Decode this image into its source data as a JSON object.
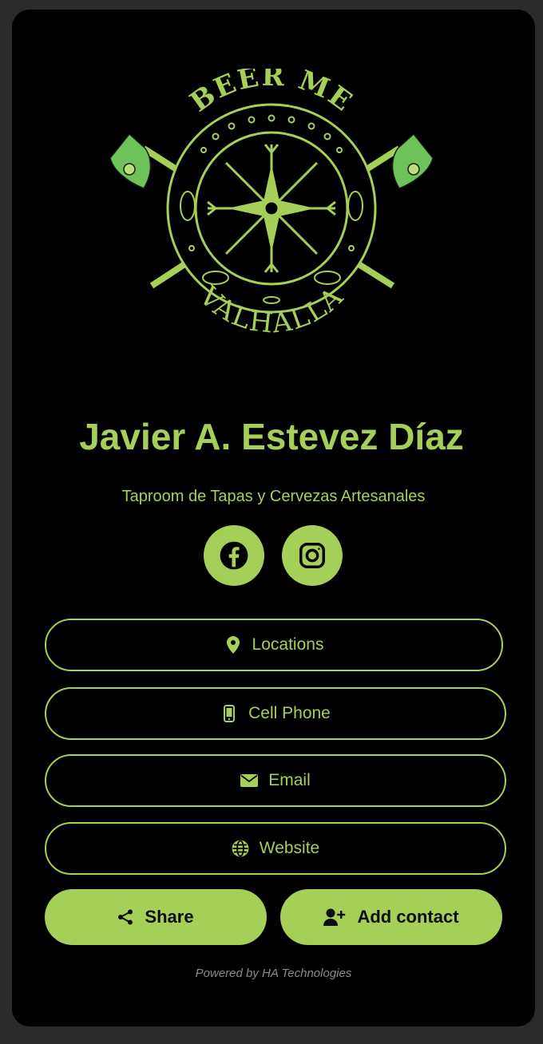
{
  "profile": {
    "logo_top_text": "BEER ME",
    "logo_bottom_text": "VALHALLA",
    "name": "Javier A. Estevez Díaz",
    "tagline": "Taproom de Tapas y Cervezas Artesanales"
  },
  "social": [
    {
      "icon": "facebook-icon"
    },
    {
      "icon": "instagram-icon"
    }
  ],
  "links": {
    "locations": {
      "label": "Locations",
      "icon": "map-pin-icon"
    },
    "cell_phone": {
      "label": "Cell Phone",
      "icon": "mobile-phone-icon"
    },
    "email": {
      "label": "Email",
      "icon": "envelope-icon"
    },
    "website": {
      "label": "Website",
      "icon": "globe-icon"
    }
  },
  "actions": {
    "share": {
      "label": "Share",
      "icon": "share-icon"
    },
    "add_contact": {
      "label": "Add contact",
      "icon": "user-plus-icon"
    }
  },
  "footer": {
    "powered_by": "Powered by HA Technologies"
  },
  "colors": {
    "accent": "#a6cf57",
    "background": "#000000",
    "page": "#2b2b2b"
  }
}
